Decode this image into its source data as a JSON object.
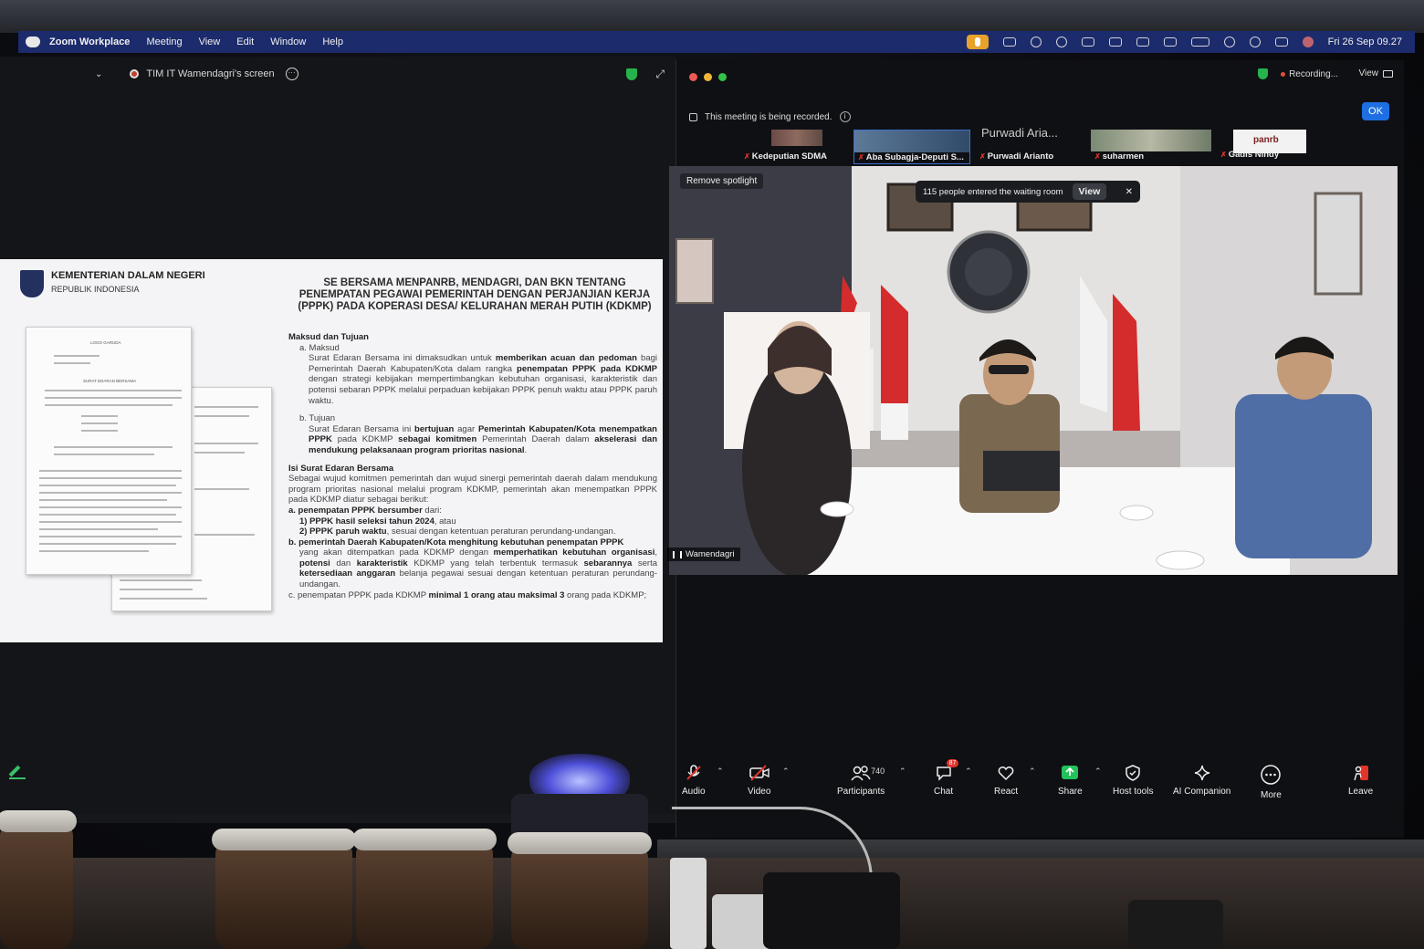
{
  "menubar": {
    "app": "Zoom Workplace",
    "items": [
      "Meeting",
      "View",
      "Edit",
      "Window",
      "Help"
    ],
    "clock": "Fri 26 Sep  09.27"
  },
  "share": {
    "title": "TIM IT Wamendagri's screen"
  },
  "document": {
    "org_name": "KEMENTERIAN DALAM NEGERI",
    "org_sub": "REPUBLIK INDONESIA",
    "title_lines": [
      "SE  BERSAMA MENPANRB,  MENDAGRI, DAN BKN TENTANG",
      "PENEMPATAN PEGAWAI PEMERINTAH DENGAN PERJANJIAN KERJA",
      "(PPPK) PADA KOPERASI DESA/ KELURAHAN MERAH PUTIH (KDKMP)"
    ],
    "sec1": "Maksud dan Tujuan",
    "a_label": "a.  Maksud",
    "a_text1": "Surat Edaran Bersama ini dimaksudkan untuk ",
    "a_bold1": "memberikan acuan dan pedoman",
    "a_text2": " bagi Pemerintah Daerah Kabupaten/Kota dalam rangka ",
    "a_bold2": "penempatan PPPK pada KDKMP",
    "a_text3": " dengan strategi kebijakan mempertimbangkan kebutuhan organisasi, karakteristik dan potensi sebaran PPPK melalui perpaduan kebijakan PPPK penuh waktu atau PPPK paruh waktu.",
    "b_label": "b.  Tujuan",
    "b_text1": "Surat Edaran Bersama ini ",
    "b_bold1": "bertujuan",
    "b_text2": " agar ",
    "b_bold2": "Pemerintah Kabupaten/Kota menempatkan PPPK",
    "b_text3": " pada KDKMP ",
    "b_bold3": "sebagai komitmen",
    "b_text4": " Pemerintah Daerah dalam ",
    "b_bold4": "akselerasi dan mendukung pelaksanaan program prioritas nasional",
    "b_text5": ".",
    "sec2": "Isi Surat Edaran Bersama",
    "isi_text": "Sebagai wujud komitmen pemerintah dan wujud sinergi pemerintah daerah dalam mendukung program prioritas nasional melalui program KDKMP, pemerintah akan menempatkan PPPK pada KDKMP diatur sebagai berikut:",
    "pa_bold": "a.  penempatan PPPK bersumber",
    "pa_text": " dari:",
    "p1": "1) PPPK hasil seleksi tahun 2024",
    "p1_tail": ", atau",
    "p2": "2) PPPK paruh waktu",
    "p2_tail": ", sesuai dengan ketentuan peraturan perundang-undangan.",
    "pb_bold": "b.  pemerintah Daerah Kabupaten/Kota menghitung kebutuhan penempatan PPPK",
    "pb_t1": "yang akan ditempatkan pada KDKMP dengan ",
    "pb_b1": "memperhatikan kebutuhan organisasi",
    "pb_t2": ", ",
    "pb_b2": "potensi",
    "pb_t3": " dan ",
    "pb_b3": "karakteristik",
    "pb_t4": " KDKMP yang telah terbentuk termasuk ",
    "pb_b4": "sebarannya",
    "pb_t5": " serta ",
    "pb_b5": "ketersediaan anggaran",
    "pb_t6": " belanja pegawai sesuai dengan ketentuan peraturan perundang-undangan.",
    "pc_t1": "c.  penempatan PPPK pada KDKMP ",
    "pc_b1": "minimal 1 orang atau maksimal 3",
    "pc_t2": " orang pada KDKMP;",
    "paper_logo": "LOGO GARUDA",
    "paper_heading": "SURAT EDARAN BERSAMA"
  },
  "meeting": {
    "recording": "Recording...",
    "view": "View",
    "recorded_notice": "This meeting is being recorded.",
    "ok": "OK",
    "remove_spotlight": "Remove spotlight",
    "waiting": "115 people entered the waiting room",
    "waiting_view": "View",
    "speaker": "Wamendagri",
    "participants": [
      "Kedeputian SDMA",
      "Aba Subagja-Deputi S...",
      "Purwadi Arianto",
      "suharmen",
      "Gadis Nindy"
    ],
    "tile_big_name": "Purwadi Aria...",
    "tile_logo": "panrb"
  },
  "toolbar": {
    "audio": "Audio",
    "video": "Video",
    "participants": "Participants",
    "participants_count": "740",
    "chat": "Chat",
    "chat_badge": "87",
    "react": "React",
    "share": "Share",
    "host_tools": "Host tools",
    "ai": "AI Companion",
    "more": "More",
    "leave": "Leave"
  },
  "colors": {
    "zoom_blue": "#1e6fe3",
    "menubar": "#1c2b6b",
    "share_green": "#21c35a",
    "recording_red": "#e74b3c",
    "mic_orange": "#e7a22c"
  }
}
